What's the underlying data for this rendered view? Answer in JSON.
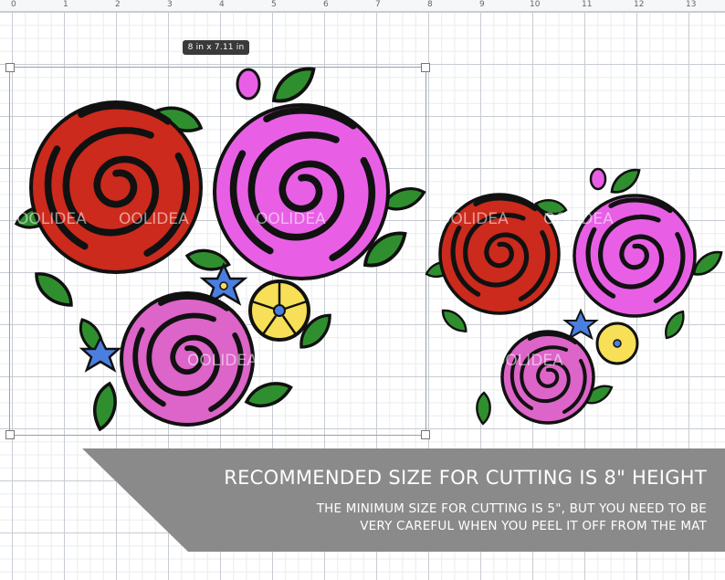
{
  "ruler": {
    "marks": [
      "0",
      "1",
      "2",
      "3",
      "4",
      "5",
      "6",
      "7",
      "8",
      "9",
      "10",
      "11",
      "12",
      "13"
    ]
  },
  "selection": {
    "size_label": "8  in x 7.11  in"
  },
  "watermark": {
    "text": "OOLIDEA"
  },
  "banner": {
    "title": "RECOMMENDED SIZE FOR CUTTING IS 8\" HEIGHT",
    "line1": "THE MINIMUM SIZE FOR CUTTING IS 5\", BUT YOU NEED TO BE",
    "line2": "VERY CAREFUL WHEN YOU PEEL IT OFF FROM THE MAT"
  },
  "colors": {
    "red_rose": "#cc2a1c",
    "magenta_rose": "#e85fe6",
    "pink_rose": "#dd64c8",
    "leaf": "#2f8f2f",
    "blue_flower": "#4a7fe0",
    "yellow_flower": "#f7df57",
    "outline": "#111111",
    "banner": "#8a8a8a"
  }
}
